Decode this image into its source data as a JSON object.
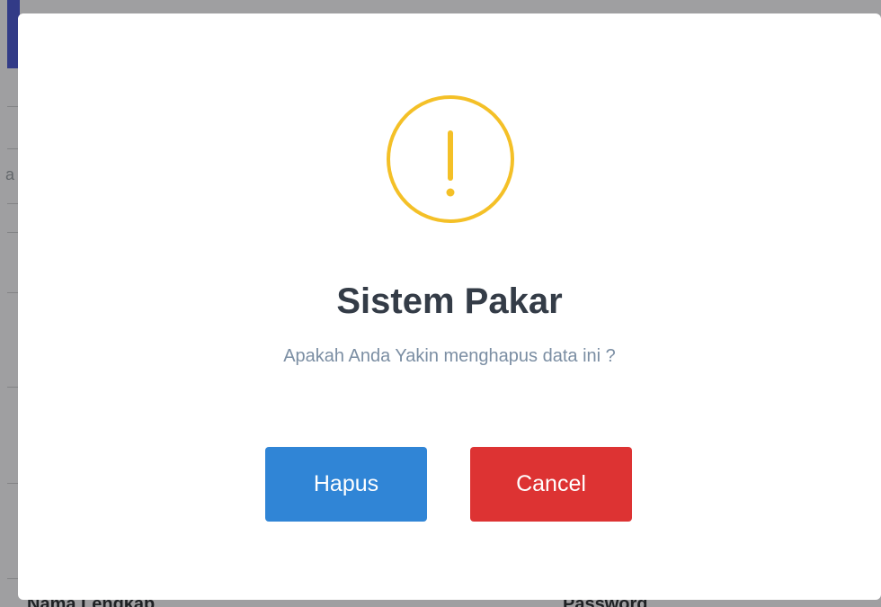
{
  "dialog": {
    "title": "Sistem Pakar",
    "message": "Apakah Anda Yakin menghapus data ini ?",
    "icon": "warning-icon",
    "confirm_label": "Hapus",
    "cancel_label": "Cancel"
  },
  "colors": {
    "warning": "#f4c027",
    "confirm": "#3085d6",
    "cancel": "#dd3333",
    "title": "#343c47",
    "message": "#7b8ea3",
    "background_accent": "#4e5bd0"
  }
}
